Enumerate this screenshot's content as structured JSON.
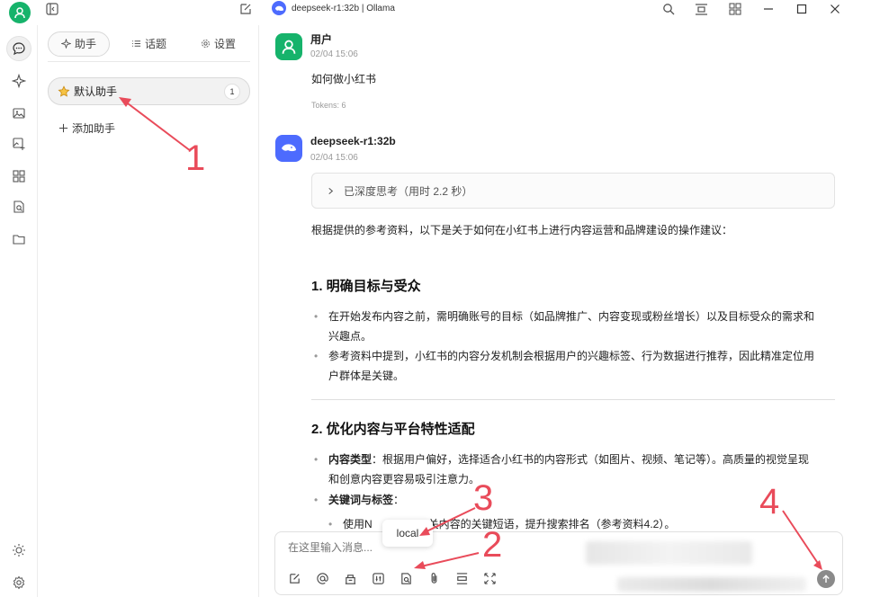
{
  "titlebar": {
    "model_title": "deepseek-r1:32b | Ollama"
  },
  "sidebar": {
    "tabs": [
      {
        "label": "助手"
      },
      {
        "label": "话题"
      },
      {
        "label": "设置"
      }
    ],
    "assistant": {
      "label": "默认助手",
      "count": "1"
    },
    "add_label": "添加助手"
  },
  "chat": {
    "user": {
      "name": "用户",
      "time": "02/04 15:06",
      "text": "如何做小红书",
      "tokens": "Tokens: 6"
    },
    "bot": {
      "name": "deepseek-r1:32b",
      "time": "02/04 15:06",
      "think": "已深度思考（用时 2.2 秒）",
      "intro": "根据提供的参考资料，以下是关于如何在小红书上进行内容运营和品牌建设的操作建议：",
      "section1": {
        "title": "1. 明确目标与受众",
        "b1_l1": "在开始发布内容之前，需明确账号的目标（如品牌推广、内容变现或粉丝增长）以及目标受众的需求和",
        "b1_l2": "兴趣点。",
        "b2_l1": "参考资料中提到，小红书的内容分发机制会根据用户的兴趣标签、行为数据进行推荐，因此精准定位用",
        "b2_l2": "户群体是关键。"
      },
      "section2": {
        "title": "2. 优化内容与平台特性适配",
        "b1_bold": "内容类型",
        "b1_l1": "：根据用户偏好，选择适合小红书的内容形式（如图片、视频、笔记等）。高质量的视觉呈现",
        "b1_l2": "和创意内容更容易吸引注意力。",
        "b2_bold": "关键词与标签",
        "b2_rest": "：",
        "sub_left": "使用N",
        "sub_right": "关内容的关键短语，提升搜索排名（参考资料4.2）。"
      }
    }
  },
  "input": {
    "placeholder": "在这里输入消息...",
    "tooltip": "local"
  },
  "annotations": [
    "1",
    "2",
    "3",
    "4"
  ],
  "colors": {
    "accent_green": "#16b36b",
    "deepseek_blue": "#4d6bfe",
    "annotation_red": "#e94b5a"
  }
}
